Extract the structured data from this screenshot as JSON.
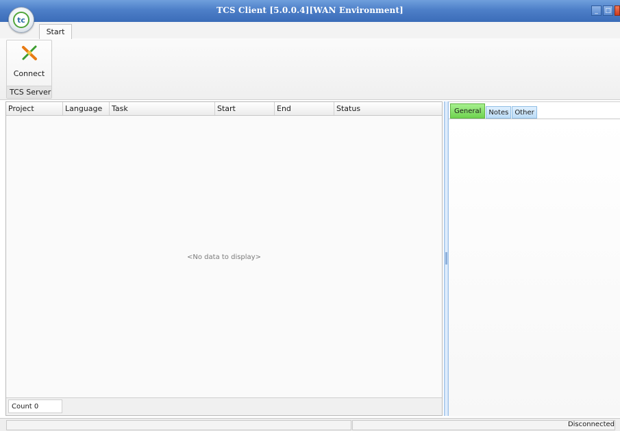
{
  "window": {
    "title": "TCS Client [5.0.0.4][WAN Environment]"
  },
  "app_button": {
    "label": "tc"
  },
  "ribbon": {
    "tabs": [
      "Start"
    ],
    "group": {
      "label": "TCS Server",
      "buttons": [
        {
          "label": "Connect",
          "icon": "connect-plug-icon"
        }
      ]
    }
  },
  "grid": {
    "columns": [
      "Project",
      "Language",
      "Task",
      "Start",
      "End",
      "Status"
    ],
    "rows": [],
    "empty_message": "<No data to display>",
    "count_label": "Count 0"
  },
  "details": {
    "tabs": [
      "General",
      "Notes",
      "Other"
    ],
    "active_tab": "General"
  },
  "statusbar": {
    "connection": "Disconnected"
  },
  "colors": {
    "title_bar": "#4d7fc8",
    "active_tab": "#6fd34f",
    "inactive_tab": "#bcdcf6",
    "splitter": "#c4dbf5"
  }
}
